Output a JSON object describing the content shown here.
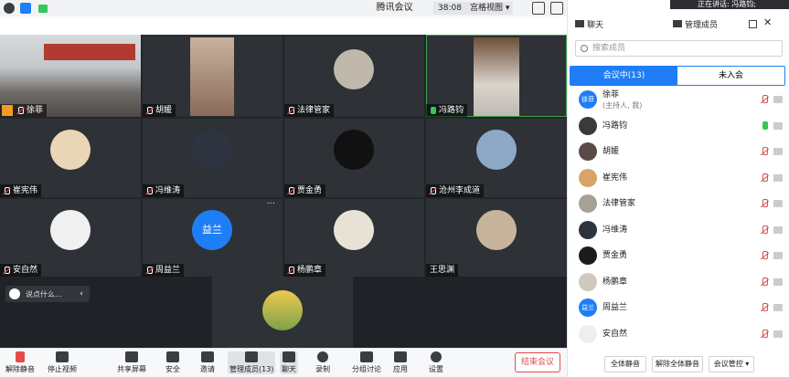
{
  "window": {
    "title": "腾讯会议"
  },
  "titlebar": {
    "time": "38:08",
    "view_label": "宫格视图"
  },
  "tiles": [
    {
      "name": "徐菲",
      "mic": "muted",
      "host": true
    },
    {
      "name": "胡媛",
      "mic": "muted"
    },
    {
      "name": "法律管家",
      "mic": "muted"
    },
    {
      "name": "冯路钧",
      "mic": "on"
    },
    {
      "name": "崔宪伟",
      "mic": "muted"
    },
    {
      "name": "冯维涛",
      "mic": "muted"
    },
    {
      "name": "贾金勇",
      "mic": "muted"
    },
    {
      "name": "沧州李成道",
      "mic": "muted"
    },
    {
      "name": "安自然",
      "mic": "muted"
    },
    {
      "name": "周益兰",
      "mic": "muted",
      "avatar_text": "益兰"
    },
    {
      "name": "杨鹏章",
      "mic": "muted"
    },
    {
      "name": "王思渊",
      "mic": "none"
    }
  ],
  "chat_input": {
    "placeholder": "说点什么..."
  },
  "toolbar": {
    "items": [
      {
        "label": "解除静音"
      },
      {
        "label": "停止视频"
      },
      {
        "label": "共享屏幕"
      },
      {
        "label": "安全"
      },
      {
        "label": "邀请"
      },
      {
        "label": "管理成员(13)"
      },
      {
        "label": "聊天"
      },
      {
        "label": "录制"
      },
      {
        "label": "分组讨论"
      },
      {
        "label": "应用"
      },
      {
        "label": "设置"
      }
    ],
    "end_label": "结束会议"
  },
  "panel": {
    "speaking": "正在讲话: 冯路钧;",
    "tab_chat": "聊天",
    "tab_members": "管理成员",
    "search_placeholder": "搜索成员",
    "seg_in": "会议中(13)",
    "seg_out": "未入会",
    "members": [
      {
        "name": "徐菲",
        "sub": "(主持人, 我)",
        "avatar_text": "徐菲",
        "mic": "muted",
        "avatar_color": "#1f7ef5"
      },
      {
        "name": "冯路钧",
        "sub": "",
        "avatar_text": "",
        "mic": "on",
        "avatar_color": "#3a3a3a"
      },
      {
        "name": "胡媛",
        "sub": "",
        "avatar_text": "",
        "mic": "muted",
        "avatar_color": "#5a4a48"
      },
      {
        "name": "崔宪伟",
        "sub": "",
        "avatar_text": "",
        "mic": "muted",
        "avatar_color": "#d9a36a"
      },
      {
        "name": "法律管家",
        "sub": "",
        "avatar_text": "",
        "mic": "muted",
        "avatar_color": "#a7a195"
      },
      {
        "name": "冯维涛",
        "sub": "",
        "avatar_text": "",
        "mic": "muted",
        "avatar_color": "#2d3440"
      },
      {
        "name": "贾金勇",
        "sub": "",
        "avatar_text": "",
        "mic": "muted",
        "avatar_color": "#1c1c1c"
      },
      {
        "name": "杨鹏章",
        "sub": "",
        "avatar_text": "",
        "mic": "muted",
        "avatar_color": "#cfc8bd"
      },
      {
        "name": "周益兰",
        "sub": "",
        "avatar_text": "益兰",
        "mic": "muted",
        "avatar_color": "#1f7ef5"
      },
      {
        "name": "安自然",
        "sub": "",
        "avatar_text": "",
        "mic": "muted",
        "avatar_color": "#eeeeee"
      }
    ],
    "btn_mute_all": "全体静音",
    "btn_unmute_all": "解除全体静音",
    "btn_control": "会议管控"
  }
}
